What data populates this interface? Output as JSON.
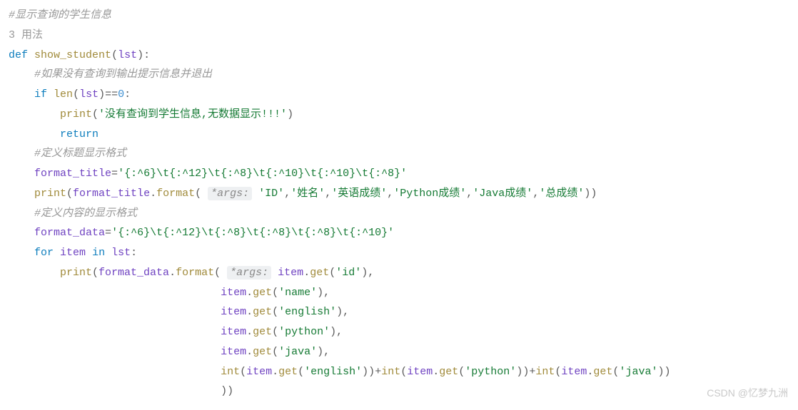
{
  "code": {
    "line1_comment": "#显示查询的学生信息",
    "line1b_usage": "3 用法",
    "line2_def": "def",
    "line2_fn": "show_student",
    "line2_params": "lst",
    "line3_comment": "#如果没有查询到输出提示信息并退出",
    "line4_if": "if",
    "line4_len": "len",
    "line4_lst": "lst",
    "line4_eq": "==",
    "line4_zero": "0",
    "line5_print": "print",
    "line5_str": "'没有查询到学生信息,无数据显示!!!'",
    "line6_return": "return",
    "line7_comment": "#定义标题显示格式",
    "line8_var": "format_title",
    "line8_str": "'{:^6}\\t{:^12}\\t{:^8}\\t{:^10}\\t{:^10}\\t{:^8}'",
    "line9_print": "print",
    "line9_ft": "format_title",
    "line9_format": "format",
    "line9_hint": "*args:",
    "line9_s1": "'ID'",
    "line9_s2": "'姓名'",
    "line9_s3": "'英语成绩'",
    "line9_s4": "'Python成绩'",
    "line9_s5": "'Java成绩'",
    "line9_s6": "'总成绩'",
    "line10_comment": "#定义内容的显示格式",
    "line11_var": "format_data",
    "line11_str": "'{:^6}\\t{:^12}\\t{:^8}\\t{:^8}\\t{:^8}\\t{:^10}'",
    "line12_for": "for",
    "line12_item": "item",
    "line12_in": "in",
    "line12_lst": "lst",
    "line13_print": "print",
    "line13_fd": "format_data",
    "line13_format": "format",
    "line13_hint": "*args:",
    "line13_item": "item",
    "line13_get": "get",
    "line13_id": "'id'",
    "line14_item": "item",
    "line14_get": "get",
    "line14_name": "'name'",
    "line15_item": "item",
    "line15_get": "get",
    "line15_eng": "'english'",
    "line16_item": "item",
    "line16_get": "get",
    "line16_py": "'python'",
    "line17_item": "item",
    "line17_get": "get",
    "line17_java": "'java'",
    "line18_int": "int",
    "line18_item": "item",
    "line18_get": "get",
    "line18_eng": "'english'",
    "line18_plus": "+",
    "line18_py": "'python'",
    "line18_java": "'java'",
    "line19_close": "))"
  },
  "watermark": "CSDN @忆梦九洲"
}
